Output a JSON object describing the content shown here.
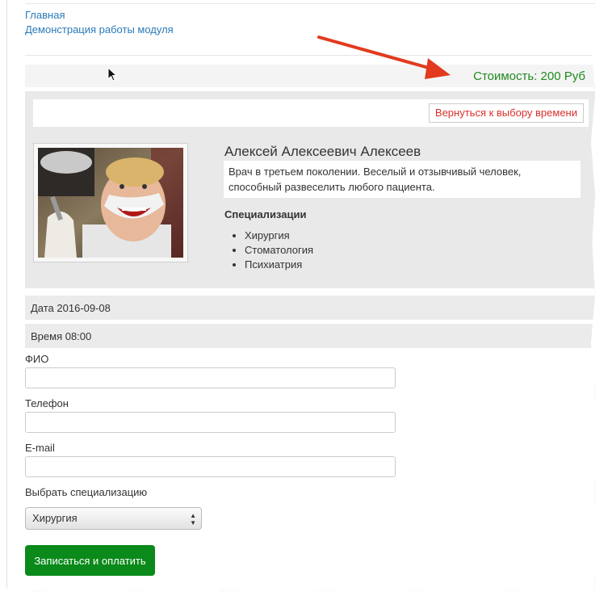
{
  "nav": {
    "home": "Главная",
    "demo": "Демонстрация работы модуля"
  },
  "price": {
    "text": "Стоимость: 200 Руб",
    "color": "#1f8a1f"
  },
  "card": {
    "back_label": "Вернуться к выбору времени",
    "doctor_name": "Алексей Алексеевич Алексеев",
    "description": "Врач в третьем поколении. Веселый и отзывчивый человек, способный развеселить любого пациента.",
    "spec_title": "Специализации",
    "specializations": [
      "Хирургия",
      "Стоматология",
      "Психиатрия"
    ]
  },
  "appointment": {
    "date": "Дата 2016-09-08",
    "time": "Время 08:00"
  },
  "form": {
    "fio_label": "ФИО",
    "phone_label": "Телефон",
    "email_label": "E-mail",
    "spec_label": "Выбрать специализацию",
    "spec_selected": "Хирургия",
    "submit_label": "Записаться и оплатить"
  },
  "colors": {
    "accent_green": "#0a8a1a",
    "link": "#2a7ab8",
    "back_red": "#d9302c"
  }
}
